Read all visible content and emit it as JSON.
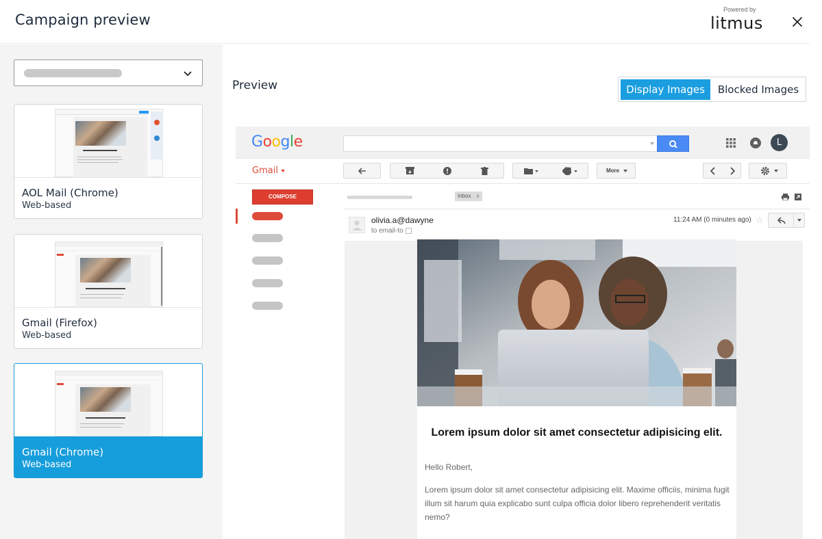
{
  "header": {
    "title": "Campaign preview",
    "powered_by": "Powered by",
    "brand": "litmus"
  },
  "sidebar": {
    "clients": [
      {
        "name": "AOL Mail (Chrome)",
        "type": "Web-based",
        "selected": false
      },
      {
        "name": "Gmail (Firefox)",
        "type": "Web-based",
        "selected": false
      },
      {
        "name": "Gmail (Chrome)",
        "type": "Web-based",
        "selected": true
      }
    ]
  },
  "preview": {
    "label": "Preview",
    "toggle": {
      "display": "Display Images",
      "blocked": "Blocked Images"
    }
  },
  "gmail": {
    "logo": "Google",
    "mail_label": "Gmail",
    "compose": "COMPOSE",
    "more": "More",
    "inbox_chip": "Inbox",
    "inbox_chip_close": "x",
    "avatar_letter": "L",
    "sender": "olivia.a@dawyne",
    "to": "to email-to",
    "time": "11:24 AM (0 minutes ago)",
    "star": "☆"
  },
  "email": {
    "title": "Lorem ipsum dolor sit amet consectetur adipisicing elit.",
    "greeting": "Hello Robert,",
    "body": "Lorem ipsum dolor sit amet consectetur adipisicing elit. Maxime officiis, minima fugit illum sit harum quia explicabo sunt culpa officia dolor libero reprehenderit veritatis nemo?"
  },
  "colors": {
    "accent": "#169ddb",
    "gmail_red": "#dd4b39",
    "search_blue": "#4a8af4"
  }
}
